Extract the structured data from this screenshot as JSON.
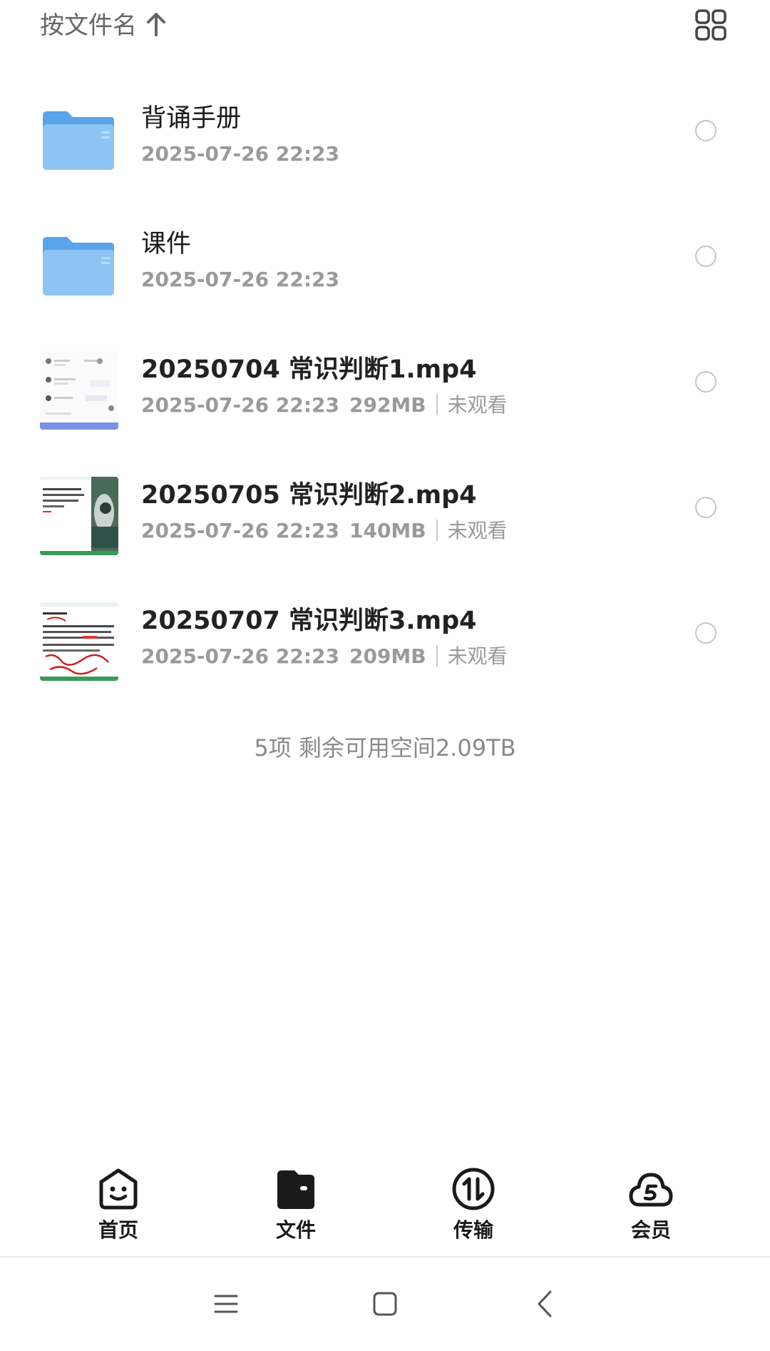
{
  "sortbar": {
    "label": "按文件名",
    "sort_icon": "arrow-up-icon",
    "view_toggle_icon": "grid-view-icon"
  },
  "files": [
    {
      "type": "folder",
      "name": "背诵手册",
      "date": "2025-07-26 22:23"
    },
    {
      "type": "folder",
      "name": "课件",
      "date": "2025-07-26 22:23"
    },
    {
      "type": "video",
      "name": "20250704 常识判断1.mp4",
      "date": "2025-07-26 22:23",
      "size": "292MB",
      "status": "未观看"
    },
    {
      "type": "video",
      "name": "20250705 常识判断2.mp4",
      "date": "2025-07-26 22:23",
      "size": "140MB",
      "status": "未观看"
    },
    {
      "type": "video",
      "name": "20250707 常识判断3.mp4",
      "date": "2025-07-26 22:23",
      "size": "209MB",
      "status": "未观看"
    }
  ],
  "summary": "5项 剩余可用空间2.09TB",
  "tabs": [
    {
      "label": "首页",
      "icon": "smiley-home-icon"
    },
    {
      "label": "文件",
      "icon": "wallet-folder-icon",
      "active": true
    },
    {
      "label": "传输",
      "icon": "transfer-icon"
    },
    {
      "label": "会员",
      "icon": "cloud-vip-icon"
    }
  ],
  "colors": {
    "folder": "#7ab8f0",
    "accent_text": "#1a1a1a",
    "meta_text": "#9a9a9a"
  }
}
